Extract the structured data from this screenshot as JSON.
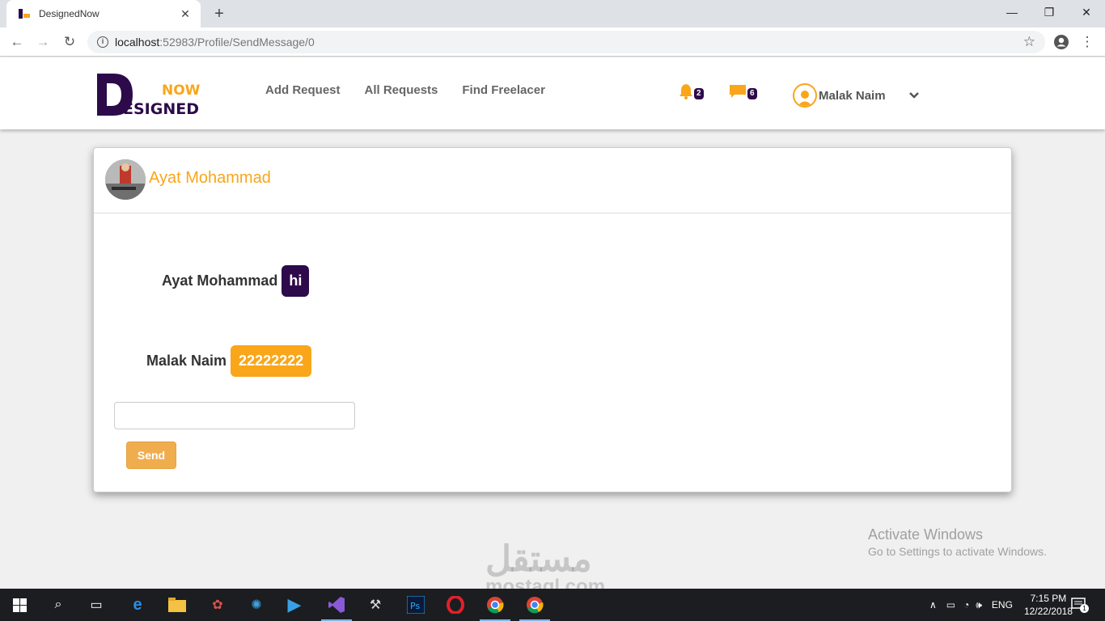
{
  "browser": {
    "tab_title": "DesignedNow",
    "url_host": "localhost",
    "url_path": ":52983/Profile/SendMessage/0"
  },
  "header": {
    "logo_text_top": "NOW",
    "logo_text_bottom": "ESIGNED",
    "logo_letter": "D",
    "nav": [
      "Add Request",
      "All Requests",
      "Find Freelacer"
    ],
    "notifications_count": "2",
    "messages_count": "6",
    "user_name": "Malak Naim"
  },
  "conversation": {
    "title": "Ayat Mohammad",
    "messages": [
      {
        "sender": "Ayat Mohammad",
        "text": "hi",
        "style": "purple"
      },
      {
        "sender": "Malak Naim",
        "text": "22222222",
        "style": "orange"
      }
    ],
    "input_value": "",
    "send_label": "Send"
  },
  "watermark": {
    "activate_line1": "Activate Windows",
    "activate_line2": "Go to Settings to activate Windows.",
    "site": "مستقل",
    "site_url": "mostaql.com"
  },
  "taskbar": {
    "lang": "ENG",
    "time": "7:15 PM",
    "date": "12/22/2018",
    "notification_count": "1"
  },
  "colors": {
    "accent_orange": "#f9a61a",
    "brand_purple": "#2d0a4a",
    "send_button": "#f0ad4e"
  }
}
